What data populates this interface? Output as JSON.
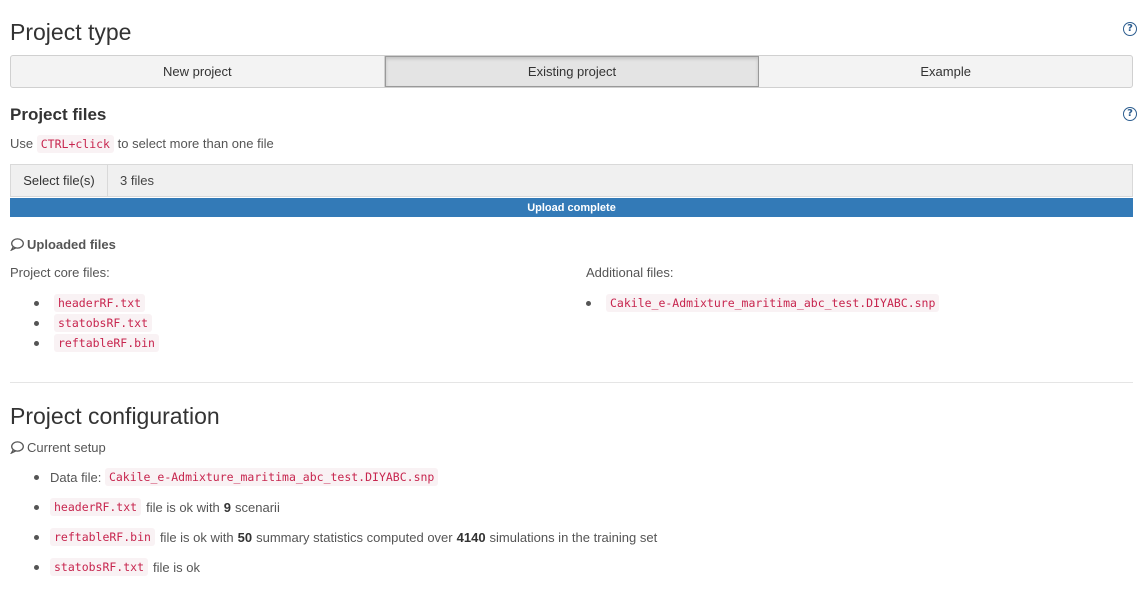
{
  "project_type": {
    "title": "Project type",
    "help_icon": "question-circle-icon",
    "options": [
      "New project",
      "Existing project",
      "Example"
    ],
    "selected": "Existing project"
  },
  "project_files": {
    "title": "Project files",
    "help_icon": "question-circle-icon",
    "hint_prefix": "Use",
    "hint_key": "CTRL+click",
    "hint_suffix": "to select more than one file",
    "select_label": "Select file(s)",
    "selected_text": "3 files",
    "progress_label": "Upload complete",
    "progress": 1.0
  },
  "uploaded": {
    "heading": "Uploaded files",
    "core_label": "Project core files:",
    "core_files": [
      "headerRF.txt",
      "statobsRF.txt",
      "reftableRF.bin"
    ],
    "additional_label": "Additional files:",
    "additional_files": [
      "Cakile_e-Admixture_maritima_abc_test.DIYABC.snp"
    ]
  },
  "configuration": {
    "title": "Project configuration",
    "setup_heading": "Current setup",
    "data_file_label": "Data file:",
    "data_file": "Cakile_e-Admixture_maritima_abc_test.DIYABC.snp",
    "header_file": "headerRF.txt",
    "header_text_a": "file is ok with",
    "header_scenarii": "9",
    "header_text_b": "scenarii",
    "reftable_file": "reftableRF.bin",
    "reftable_text_a": "file is ok with",
    "reftable_stats": "50",
    "reftable_text_b": "summary statistics computed over",
    "reftable_sims": "4140",
    "reftable_text_c": "simulations in the training set",
    "statobs_file": "statobsRF.txt",
    "statobs_text": "file is ok"
  },
  "colors": {
    "accent": "#337ab7",
    "code": "#c7254e",
    "help": "#2c5d8f"
  }
}
